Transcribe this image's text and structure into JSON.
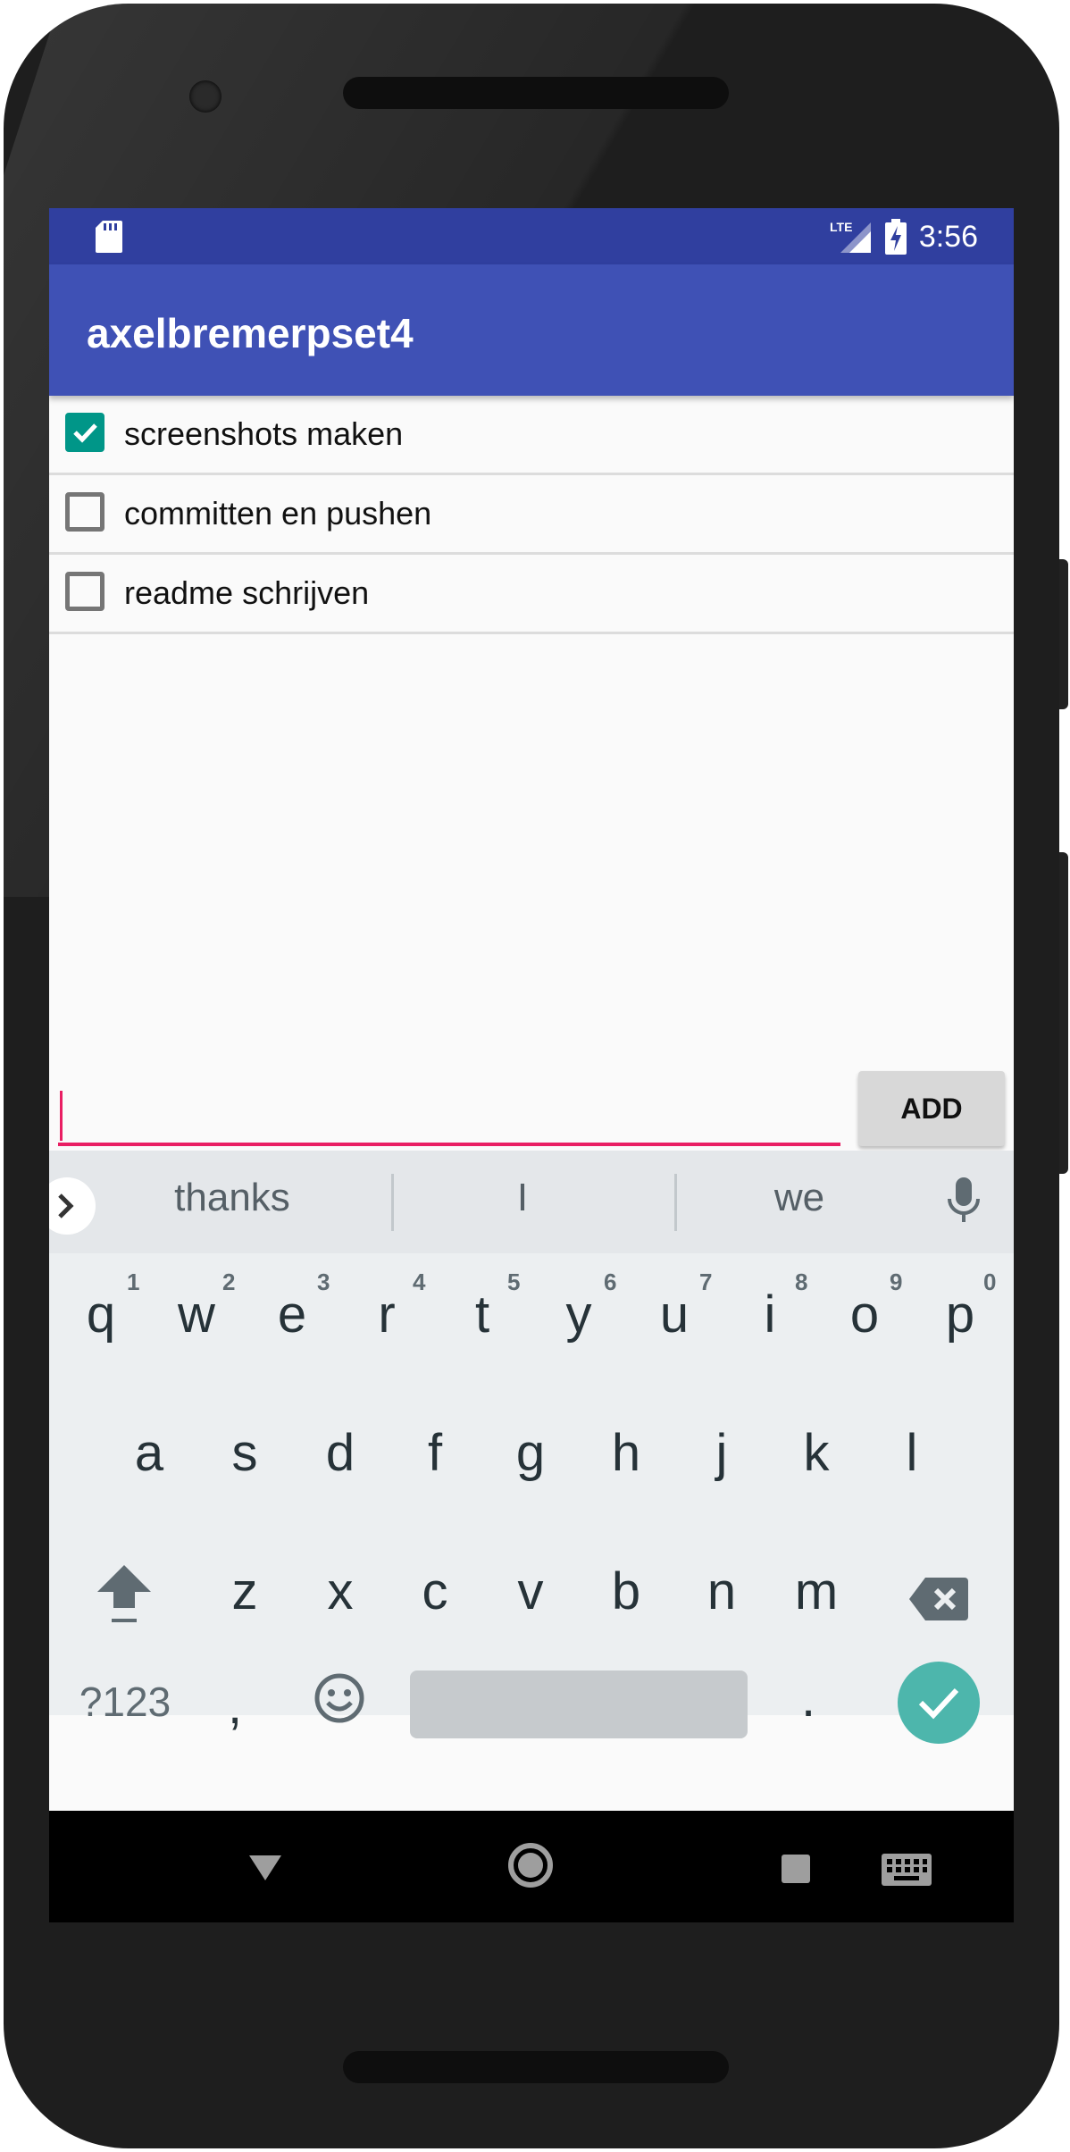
{
  "status_bar": {
    "time": "3:56",
    "network": "LTE",
    "icons": [
      "sd-card-icon",
      "lte-signal-icon",
      "battery-charging-icon"
    ]
  },
  "app": {
    "title": "axelbremerpset4",
    "primary_color": "#3f51b5",
    "status_color": "#303f9f",
    "accent_color": "#e91e63",
    "check_color": "#009688"
  },
  "todo_list": {
    "items": [
      {
        "label": "screenshots maken",
        "checked": true
      },
      {
        "label": "committen en pushen",
        "checked": false
      },
      {
        "label": "readme schrijven",
        "checked": false
      }
    ]
  },
  "input": {
    "value": "",
    "add_label": "ADD"
  },
  "keyboard": {
    "suggestions": [
      "thanks",
      "I",
      "we"
    ],
    "row1": [
      "q",
      "w",
      "e",
      "r",
      "t",
      "y",
      "u",
      "i",
      "o",
      "p"
    ],
    "row1_hints": [
      "1",
      "2",
      "3",
      "4",
      "5",
      "6",
      "7",
      "8",
      "9",
      "0"
    ],
    "row2": [
      "a",
      "s",
      "d",
      "f",
      "g",
      "h",
      "j",
      "k",
      "l"
    ],
    "row3": [
      "z",
      "x",
      "c",
      "v",
      "b",
      "n",
      "m"
    ],
    "symbols_label": "?123",
    "comma": ",",
    "period": "."
  }
}
